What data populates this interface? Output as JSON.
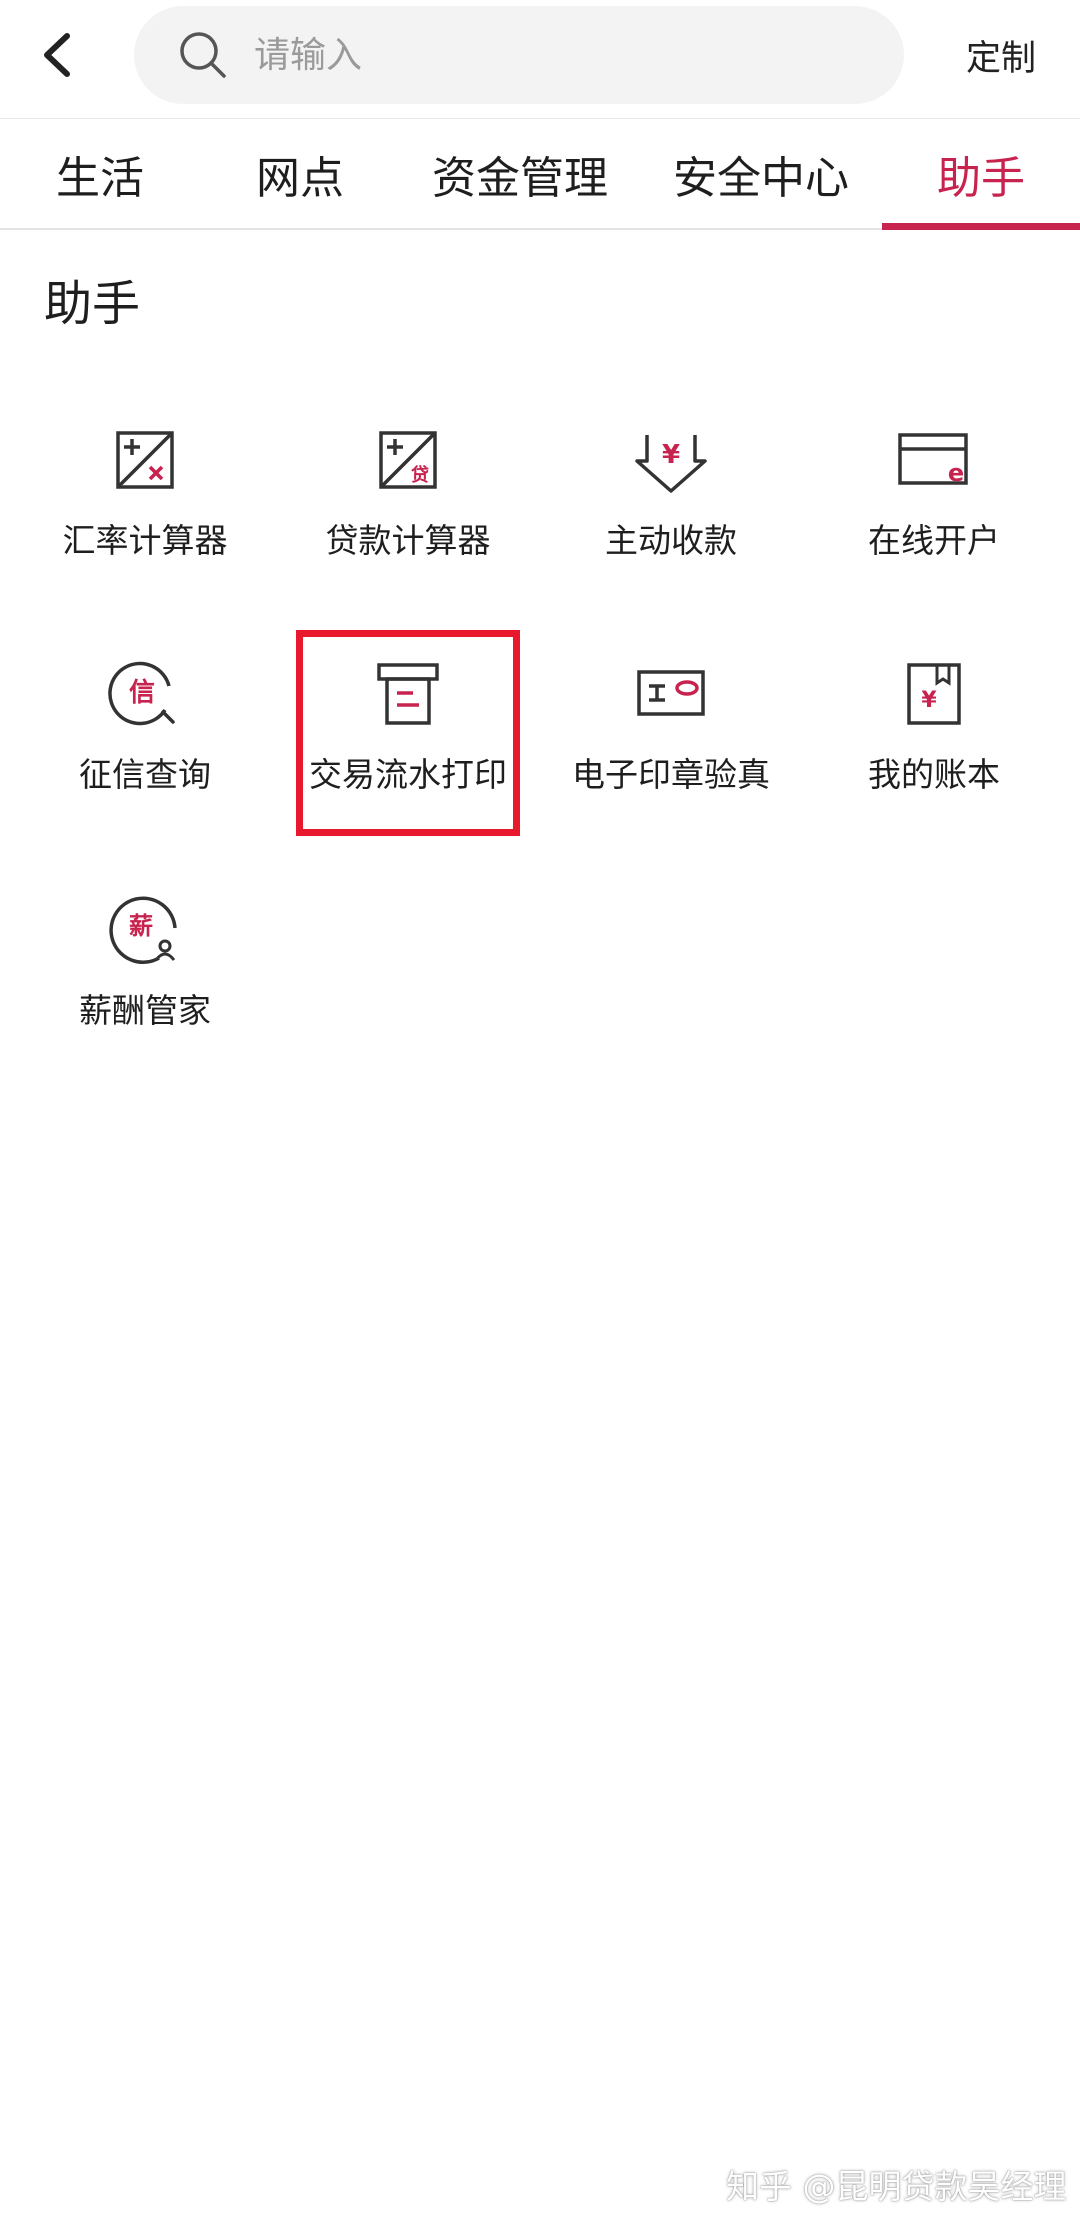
{
  "header": {
    "search_placeholder": "请输入",
    "customize_label": "定制"
  },
  "tabs": [
    {
      "label": "生活",
      "active": false
    },
    {
      "label": "网点",
      "active": false
    },
    {
      "label": "资金管理",
      "active": false
    },
    {
      "label": "安全中心",
      "active": false
    },
    {
      "label": "助手",
      "active": true
    }
  ],
  "section": {
    "title": "助手",
    "items": [
      {
        "label": "汇率计算器",
        "icon": "exchange-calculator-icon"
      },
      {
        "label": "贷款计算器",
        "icon": "loan-calculator-icon",
        "icon_text": "贷"
      },
      {
        "label": "主动收款",
        "icon": "receive-payment-icon",
        "icon_text": "¥"
      },
      {
        "label": "在线开户",
        "icon": "online-account-icon",
        "icon_text": "e"
      },
      {
        "label": "征信查询",
        "icon": "credit-query-icon",
        "icon_text": "信"
      },
      {
        "label": "交易流水打印",
        "icon": "print-statement-icon",
        "highlighted": true
      },
      {
        "label": "电子印章验真",
        "icon": "seal-verify-icon"
      },
      {
        "label": "我的账本",
        "icon": "ledger-icon",
        "icon_text": "¥"
      },
      {
        "label": "薪酬管家",
        "icon": "salary-manager-icon",
        "icon_text": "薪"
      }
    ]
  },
  "watermark": "知乎 @昆明贷款吴经理",
  "colors": {
    "accent": "#c8234e",
    "highlight": "#e8192c",
    "icon_stroke": "#333333"
  }
}
